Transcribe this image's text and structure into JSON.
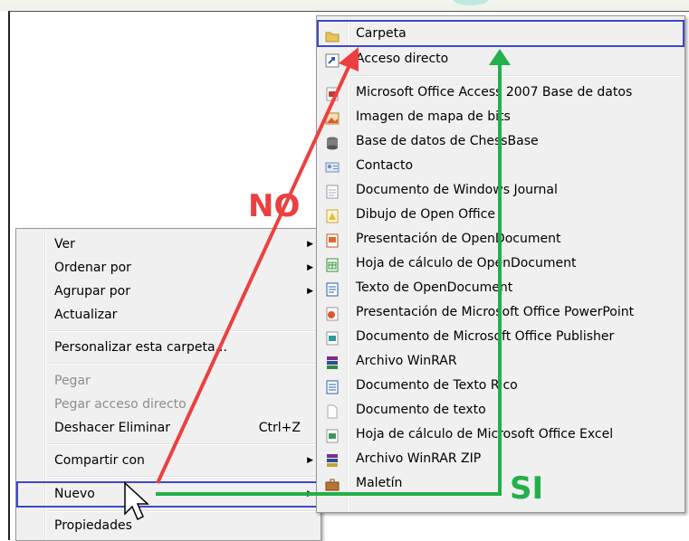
{
  "context_menu": {
    "items": [
      {
        "label": "Ver"
      },
      {
        "label": "Ordenar por"
      },
      {
        "label": "Agrupar por"
      },
      {
        "label": "Actualizar"
      },
      {
        "label": "Personalizar esta carpeta..."
      },
      {
        "label": "Pegar"
      },
      {
        "label": "Pegar acceso directo"
      },
      {
        "label": "Deshacer Eliminar",
        "shortcut": "Ctrl+Z"
      },
      {
        "label": "Compartir con"
      },
      {
        "label": "Nuevo"
      },
      {
        "label": "Propiedades"
      }
    ]
  },
  "new_submenu": {
    "items": [
      {
        "label": "Carpeta",
        "icon": "folder-icon"
      },
      {
        "label": "Acceso directo",
        "icon": "shortcut-icon"
      },
      {
        "label": "Microsoft Office Access 2007 Base de datos",
        "icon": "access-icon"
      },
      {
        "label": "Imagen de mapa de bits",
        "icon": "bitmap-icon"
      },
      {
        "label": "Base de datos de ChessBase",
        "icon": "database-icon"
      },
      {
        "label": "Contacto",
        "icon": "contact-icon"
      },
      {
        "label": "Documento de Windows Journal",
        "icon": "journal-icon"
      },
      {
        "label": "Dibujo de Open Office",
        "icon": "draw-icon"
      },
      {
        "label": "Presentación de OpenDocument",
        "icon": "presentation-icon"
      },
      {
        "label": "Hoja de cálculo de OpenDocument",
        "icon": "spreadsheet-icon"
      },
      {
        "label": "Texto de OpenDocument",
        "icon": "text-document-icon"
      },
      {
        "label": "Presentación de Microsoft Office PowerPoint",
        "icon": "powerpoint-icon"
      },
      {
        "label": "Documento de Microsoft Office Publisher",
        "icon": "publisher-icon"
      },
      {
        "label": "Archivo WinRAR",
        "icon": "winrar-icon"
      },
      {
        "label": "Documento de Texto Rico",
        "icon": "rtf-icon"
      },
      {
        "label": "Documento de texto",
        "icon": "text-file-icon"
      },
      {
        "label": "Hoja de cálculo de Microsoft Office Excel",
        "icon": "excel-icon"
      },
      {
        "label": "Archivo WinRAR ZIP",
        "icon": "winrar-zip-icon"
      },
      {
        "label": "Maletín",
        "icon": "briefcase-icon"
      }
    ]
  },
  "annotations": {
    "no": "NO",
    "si": "SI",
    "colors": {
      "no": "#ec4040",
      "si": "#22b04a",
      "highlight": "#3d48c8"
    }
  }
}
